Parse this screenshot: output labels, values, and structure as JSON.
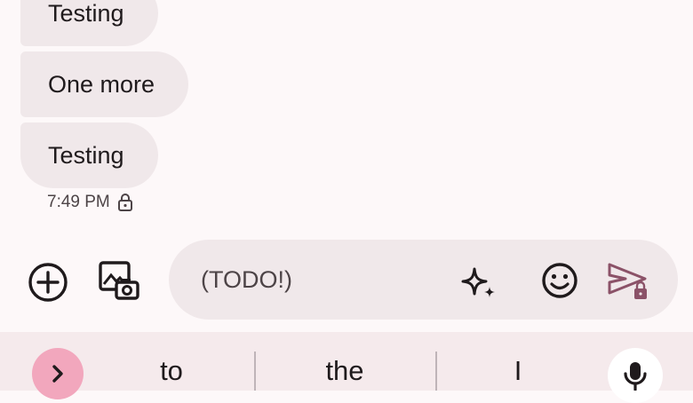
{
  "messages": [
    {
      "text": "Testing"
    },
    {
      "text": "One more"
    },
    {
      "text": "Testing"
    }
  ],
  "last_message_meta": {
    "time": "7:49 PM",
    "icon": "lock-icon"
  },
  "compose": {
    "add_icon": "add-circle-icon",
    "media_icon": "gallery-camera-icon",
    "placeholder": "(TODO!)",
    "value": "",
    "magic_icon": "sparkle-icon",
    "emoji_icon": "emoji-icon",
    "send_icon": "send-locked-icon"
  },
  "keyboard": {
    "expand_icon": "chevron-right-icon",
    "suggestions": [
      "to",
      "the",
      "I"
    ],
    "mic_icon": "microphone-icon"
  },
  "colors": {
    "bubble": "#f0e8ea",
    "background": "#fdf8f9",
    "send": "#8b5268",
    "expand_button": "#f2a7bd",
    "suggestion_bar": "#f5eaec"
  }
}
